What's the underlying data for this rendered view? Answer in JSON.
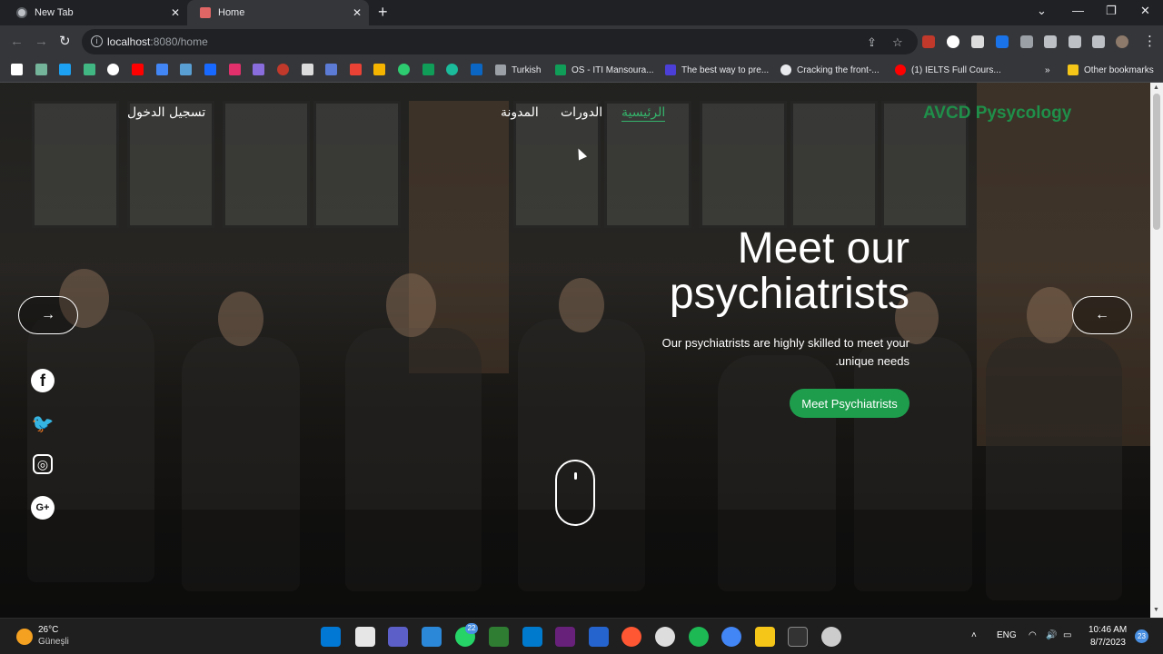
{
  "browser": {
    "tabs": [
      {
        "title": "New Tab",
        "active": false
      },
      {
        "title": "Home",
        "active": true
      }
    ],
    "url": {
      "host": "localhost",
      "rest": ":8080/home"
    },
    "bookmarks": [
      {
        "label": "Turkish"
      },
      {
        "label": "OS - ITI Mansoura..."
      },
      {
        "label": "The best way to pre..."
      },
      {
        "label": "Cracking the front-..."
      },
      {
        "label": "(1) IELTS Full Cours..."
      },
      {
        "label": "Other bookmarks"
      }
    ],
    "overflow": "»"
  },
  "site": {
    "brand": "AVCD Pysycology",
    "nav": [
      {
        "label": "الرئيسية",
        "active": true
      },
      {
        "label": "الدورات",
        "active": false
      },
      {
        "label": "المدونة",
        "active": false
      }
    ],
    "login": "تسجيل الدخول",
    "hero": {
      "headline_line1": "Meet our",
      "headline_line2": "psychiatrists",
      "subtext_line1": "Our psychiatrists are highly skilled to meet your",
      "subtext_line2": ".unique needs",
      "cta": "Meet Psychiatrists"
    },
    "carousel": {
      "prev_icon": "→",
      "next_icon": "←"
    },
    "social": [
      {
        "name": "facebook",
        "glyph": "f"
      },
      {
        "name": "twitter",
        "glyph": "🐦"
      },
      {
        "name": "instagram",
        "glyph": "◎"
      },
      {
        "name": "google-plus",
        "glyph": "G+"
      }
    ],
    "accent": "#35b36b",
    "brand_color": "#1f8f4a",
    "cta_color": "#1e9e4d"
  },
  "taskbar": {
    "weather_temp": "26°C",
    "weather_desc": "Güneşli",
    "whatsapp_badge": "22",
    "language": "ENG",
    "time": "10:46 AM",
    "date": "8/7/2023",
    "notifications": "23"
  }
}
